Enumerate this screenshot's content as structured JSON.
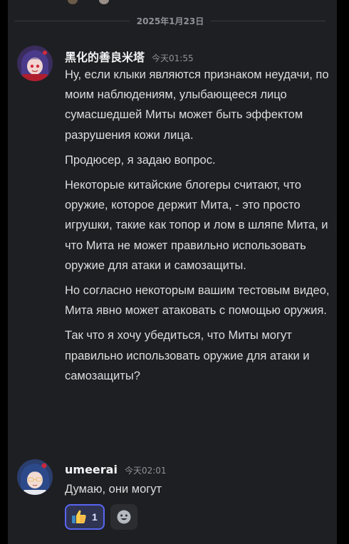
{
  "date_divider": "2025年1月23日",
  "messages": [
    {
      "author": "黑化的善良米塔",
      "time": "今天01:55",
      "paragraphs": [
        "Ну, если клыки являются признаком неудачи, по моим наблюдениям, улыбающееся лицо сумасшедшей Миты может быть эффектом разрушения кожи лица.",
        "Продюсер, я задаю вопрос.",
        "Некоторые китайские блогеры считают, что оружие, которое держит Мита, - это просто игрушки, такие как топор и лом в шляпе Мита, и что Мита не может правильно использовать оружие для атаки и самозащиты.",
        "Но согласно некоторым вашим тестовым видео, Мита явно может атаковать с помощью оружия.",
        "Так что я хочу убедиться, что Миты могут правильно использовать оружие для атаки и самозащиты?"
      ]
    },
    {
      "author": "umeerai",
      "time": "今天02:01",
      "paragraphs": [
        "Думаю, они могут"
      ]
    }
  ],
  "reactions": [
    {
      "emoji": "thumbs-up-icon",
      "count": "1",
      "active": true
    }
  ],
  "add_reaction_icon": "add-reaction-smiley-icon",
  "colors": {
    "background": "#1e1f22",
    "text": "#dcddde",
    "muted": "#8e9297",
    "accent": "#5865f2"
  }
}
